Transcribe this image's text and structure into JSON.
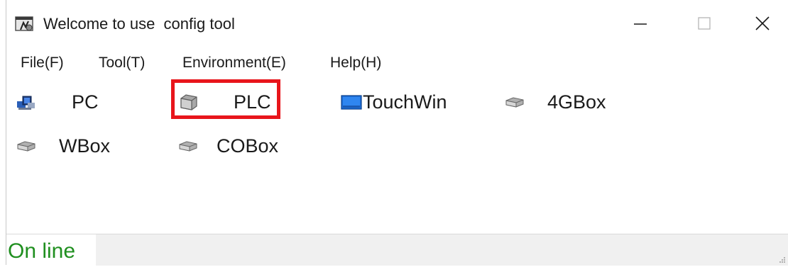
{
  "window": {
    "title": "Welcome to use  config tool",
    "icons": {
      "app": "config-tool-icon",
      "minimize": "minimize-icon",
      "maximize": "maximize-icon",
      "close": "close-icon"
    }
  },
  "menu": {
    "items": [
      {
        "label": "File(F)"
      },
      {
        "label": "Tool(T)"
      },
      {
        "label": "Environment(E)"
      },
      {
        "label": "Help(H)"
      }
    ]
  },
  "devices": [
    {
      "label": "PC",
      "icon": "pc-icon"
    },
    {
      "label": "PLC",
      "icon": "plc-icon",
      "highlighted": true
    },
    {
      "label": "TouchWin",
      "icon": "touchwin-icon"
    },
    {
      "label": "4GBox",
      "icon": "box-device-icon"
    },
    {
      "label": "WBox",
      "icon": "box-device-icon"
    },
    {
      "label": "COBox",
      "icon": "box-device-icon"
    }
  ],
  "status": {
    "text": "On line",
    "color": "#1f8f1f"
  },
  "colors": {
    "highlight": "#e8151b",
    "touchwin_screen": "#1e6fd9"
  }
}
